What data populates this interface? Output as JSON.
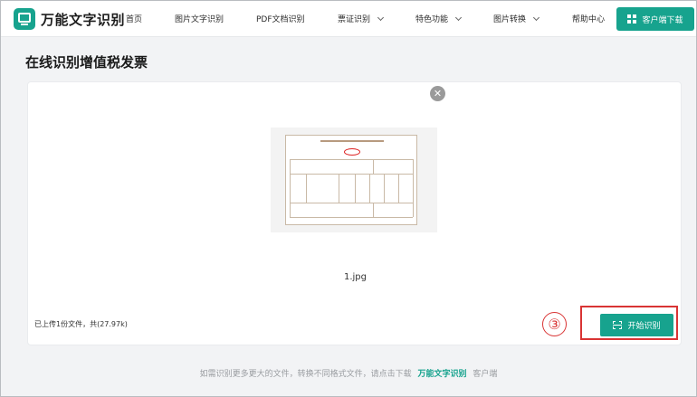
{
  "brand": {
    "name": "万能文字识别",
    "icon": "monitor-logo-icon"
  },
  "nav": {
    "items": [
      {
        "label": "首页",
        "dropdown": false
      },
      {
        "label": "图片文字识别",
        "dropdown": false
      },
      {
        "label": "PDF文档识别",
        "dropdown": false
      },
      {
        "label": "票证识别",
        "dropdown": true
      },
      {
        "label": "特色功能",
        "dropdown": true
      },
      {
        "label": "图片转换",
        "dropdown": true
      },
      {
        "label": "帮助中心",
        "dropdown": false
      }
    ],
    "download_label": "客户端下载",
    "download_icon": "windows-icon"
  },
  "page": {
    "title": "在线识别增值税发票"
  },
  "upload": {
    "file_name": "1.jpg",
    "status": "已上传1份文件，共(27.97k)",
    "start_label": "开始识别",
    "start_icon": "scan-icon",
    "close_icon": "close-icon"
  },
  "annotation": {
    "step": "③",
    "color": "#d93434"
  },
  "footer": {
    "prefix": "如需识别更多更大的文件，转换不同格式文件，请点击下载",
    "brand": "万能文字识别",
    "suffix": "客户端"
  },
  "colors": {
    "accent": "#17a38e",
    "background": "#f2f3f5",
    "annotation": "#d93434"
  }
}
